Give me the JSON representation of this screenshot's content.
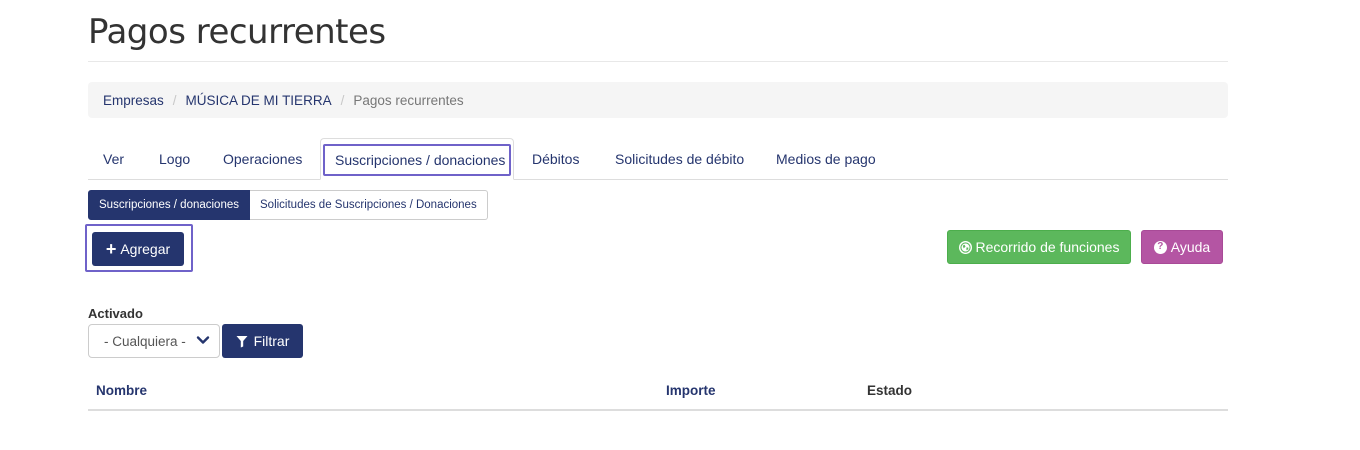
{
  "page": {
    "title": "Pagos recurrentes"
  },
  "breadcrumb": {
    "items": [
      {
        "label": "Empresas"
      },
      {
        "label": "MÚSICA DE MI TIERRA"
      }
    ],
    "current": "Pagos recurrentes",
    "separator": "/"
  },
  "tabs": [
    {
      "label": "Ver",
      "active": false
    },
    {
      "label": "Logo",
      "active": false
    },
    {
      "label": "Operaciones",
      "active": false
    },
    {
      "label": "Suscripciones / donaciones",
      "active": true
    },
    {
      "label": "Débitos",
      "active": false
    },
    {
      "label": "Solicitudes de débito",
      "active": false
    },
    {
      "label": "Medios de pago",
      "active": false
    }
  ],
  "subtabs": [
    {
      "label": "Suscripciones / donaciones",
      "active": true
    },
    {
      "label": "Solicitudes de Suscripciones / Donaciones",
      "active": false
    }
  ],
  "actions": {
    "add_icon": "plus-icon",
    "add_label": "Agregar",
    "tour_icon": "globe-icon",
    "tour_label": "Recorrido de funciones",
    "help_icon": "question-circle-icon",
    "help_label": "Ayuda"
  },
  "filter": {
    "label": "Activado",
    "selected": "- Cualquiera -",
    "button_icon": "filter-icon",
    "button_label": "Filtrar"
  },
  "table": {
    "columns": [
      {
        "label": "Nombre",
        "sortable": true
      },
      {
        "label": "Importe",
        "sortable": true
      },
      {
        "label": "Estado",
        "sortable": false
      }
    ]
  },
  "colors": {
    "primary": "#25356e",
    "success": "#5cb85c",
    "help": "#b455a3",
    "focus_outline": "#6f62c9"
  }
}
